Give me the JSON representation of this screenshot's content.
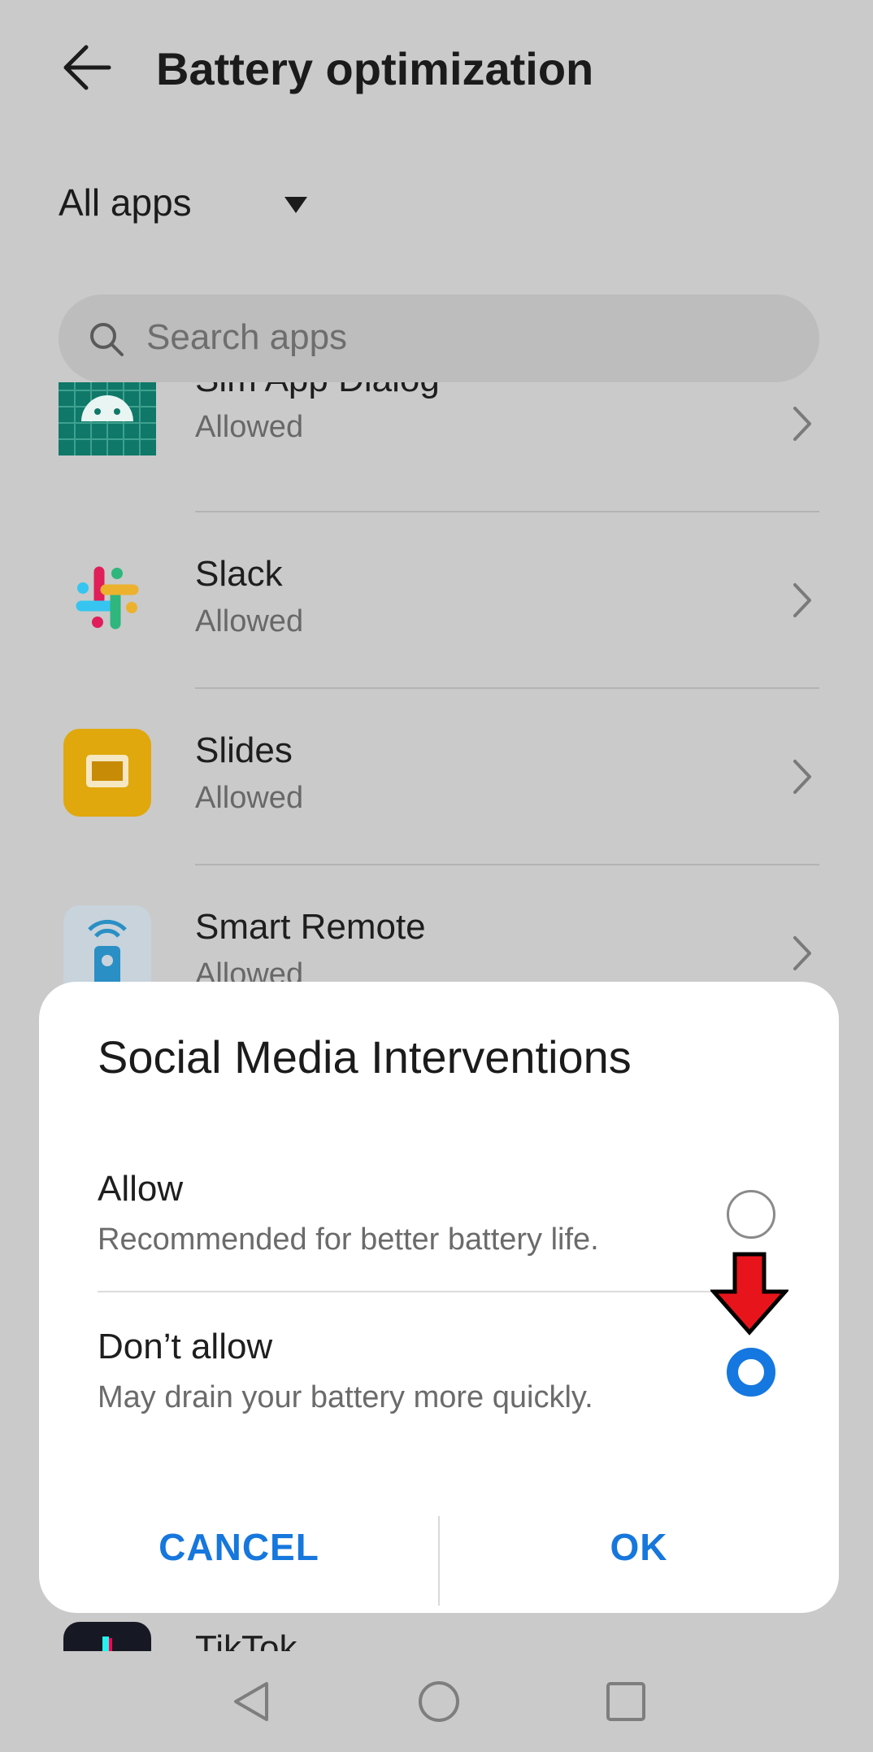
{
  "header": {
    "title": "Battery optimization",
    "back_icon": "arrow-left-icon"
  },
  "filter": {
    "label": "All apps",
    "icon": "caret-down-icon"
  },
  "search": {
    "placeholder": "Search apps",
    "icon": "search-icon"
  },
  "apps": [
    {
      "name": "Sim App Dialog",
      "status": "Allowed",
      "icon": "android-icon"
    },
    {
      "name": "Slack",
      "status": "Allowed",
      "icon": "slack-icon"
    },
    {
      "name": "Slides",
      "status": "Allowed",
      "icon": "slides-icon"
    },
    {
      "name": "Smart Remote",
      "status": "Allowed",
      "icon": "remote-icon"
    },
    {
      "name": "TikTok",
      "status": "",
      "icon": "tiktok-icon"
    }
  ],
  "dialog": {
    "title": "Social Media Interventions",
    "options": [
      {
        "title": "Allow",
        "description": "Recommended for better battery life.",
        "selected": false
      },
      {
        "title": "Don’t allow",
        "description": "May drain your battery more quickly.",
        "selected": true
      }
    ],
    "cancel_label": "CANCEL",
    "ok_label": "OK"
  },
  "colors": {
    "accent": "#1677dd",
    "scrim": "#cacaca",
    "annotation_arrow": "#e8141b"
  },
  "navbar": {
    "icons": [
      "back-triangle-icon",
      "home-circle-icon",
      "recents-square-icon"
    ]
  }
}
